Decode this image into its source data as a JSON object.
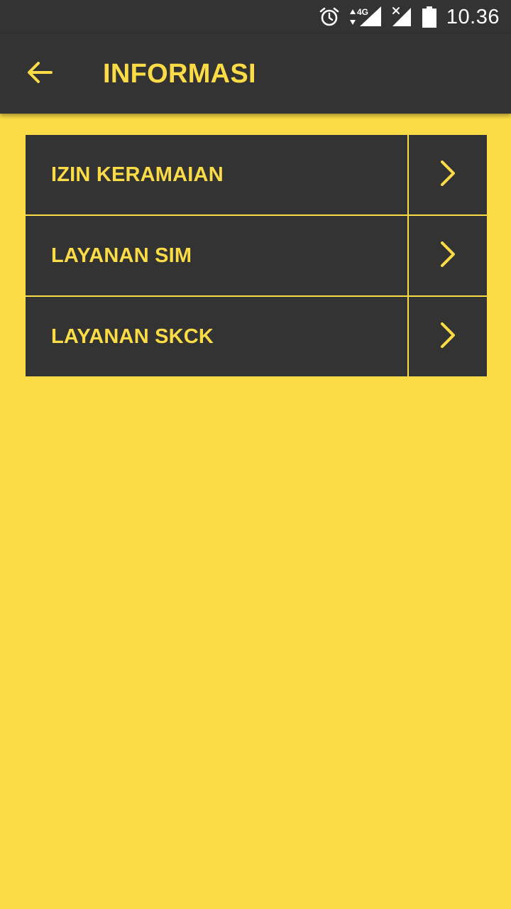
{
  "status_bar": {
    "time": "10.36",
    "network_label": "4G",
    "icons": [
      "alarm-icon",
      "data-arrows-icon",
      "signal-icon",
      "no-signal-icon",
      "battery-icon"
    ]
  },
  "app_bar": {
    "title": "INFORMASI",
    "back_icon": "arrow-left-icon"
  },
  "menu": {
    "items": [
      {
        "label": "IZIN KERAMAIAN",
        "icon": "chevron-right-icon"
      },
      {
        "label": "LAYANAN SIM",
        "icon": "chevron-right-icon"
      },
      {
        "label": "LAYANAN SKCK",
        "icon": "chevron-right-icon"
      }
    ]
  },
  "colors": {
    "accent": "#FCDC46",
    "bar": "#333333"
  }
}
